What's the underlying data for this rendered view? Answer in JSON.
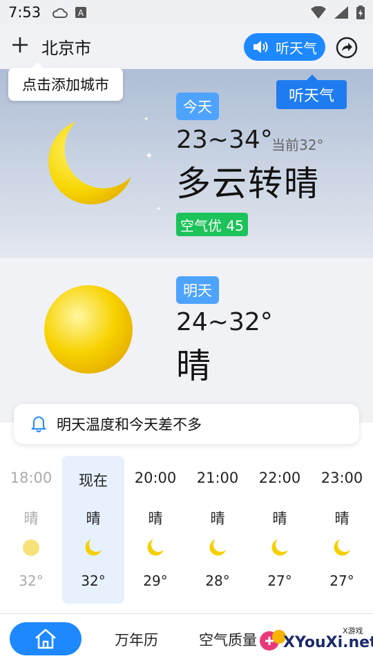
{
  "status_bar": {
    "time": "7:53"
  },
  "header": {
    "city": "北京市",
    "listen_label": "听天气"
  },
  "tooltips": {
    "add_city": "点击添加城市",
    "listen": "听天气"
  },
  "today": {
    "badge": "今天",
    "temp_range": "23~34°",
    "current_temp": "当前32°",
    "condition": "多云转晴",
    "aqi": "空气优 45"
  },
  "tomorrow": {
    "badge": "明天",
    "temp_range": "24~32°",
    "condition": "晴"
  },
  "notice": "明天温度和今天差不多",
  "hourly": [
    {
      "time": "18:00",
      "cond": "晴",
      "icon": "sun-icon",
      "temp": "32°"
    },
    {
      "time": "现在",
      "cond": "晴",
      "icon": "moon-icon",
      "temp": "32°"
    },
    {
      "time": "20:00",
      "cond": "晴",
      "icon": "moon-icon",
      "temp": "29°"
    },
    {
      "time": "21:00",
      "cond": "晴",
      "icon": "moon-icon",
      "temp": "28°"
    },
    {
      "time": "22:00",
      "cond": "晴",
      "icon": "moon-icon",
      "temp": "27°"
    },
    {
      "time": "23:00",
      "cond": "晴",
      "icon": "moon-icon",
      "temp": "27°"
    }
  ],
  "bottom_nav": {
    "home": "home-icon",
    "calendar": "万年历",
    "air_quality": "空气质量"
  },
  "watermark": {
    "text": "XYouXi.net",
    "small": "X游戏"
  },
  "colors": {
    "accent": "#1e88ff",
    "aqi_good": "#1cc35a",
    "badge": "#4ea3ff",
    "moon": "#f5d000"
  }
}
